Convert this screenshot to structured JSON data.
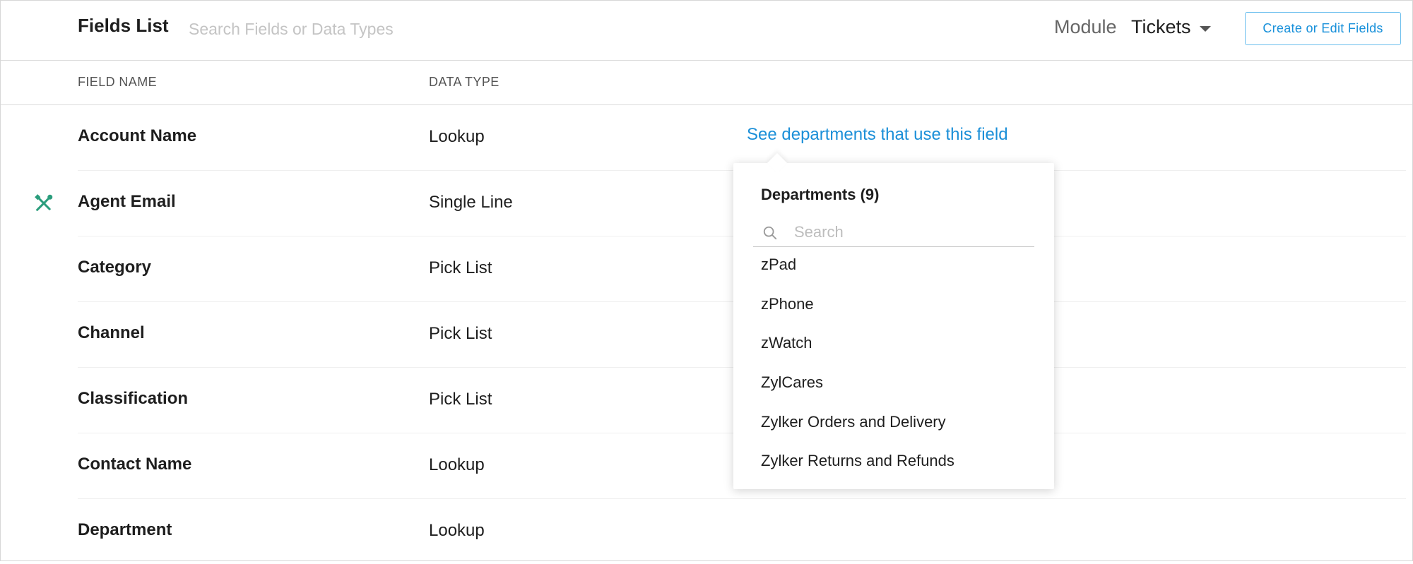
{
  "header": {
    "title": "Fields List",
    "search_placeholder": "Search Fields or Data Types",
    "module_label": "Module",
    "module_value": "Tickets",
    "create_button": "Create or Edit Fields"
  },
  "table": {
    "columns": [
      "FIELD NAME",
      "DATA TYPE"
    ],
    "rows": [
      {
        "name": "Account Name",
        "type": "Lookup",
        "link": "See departments that use this field",
        "icon": ""
      },
      {
        "name": "Agent Email",
        "type": "Single Line",
        "link": "",
        "icon": "wrench-icon"
      },
      {
        "name": "Category",
        "type": "Pick List",
        "link": "",
        "icon": ""
      },
      {
        "name": "Channel",
        "type": "Pick List",
        "link": "",
        "icon": ""
      },
      {
        "name": "Classification",
        "type": "Pick List",
        "link": "",
        "icon": ""
      },
      {
        "name": "Contact Name",
        "type": "Lookup",
        "link": "",
        "icon": ""
      },
      {
        "name": "Department",
        "type": "Lookup",
        "link": "",
        "icon": ""
      }
    ]
  },
  "popover": {
    "title": "Departments (9)",
    "search_placeholder": "Search",
    "items": [
      "zPad",
      "zPhone",
      "zWatch",
      "ZylCares",
      "Zylker Orders and Delivery",
      "Zylker Returns and Refunds"
    ]
  },
  "colors": {
    "accent": "#1b8fd8",
    "wrench": "#2a9d7c",
    "border": "#dcdcdc"
  }
}
